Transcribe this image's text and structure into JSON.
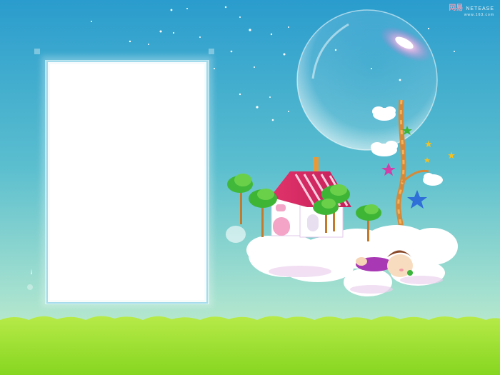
{
  "watermark": {
    "logo_text": "网易",
    "brand": "NETEASE",
    "url": "www.163.com"
  },
  "photo_frame": {
    "content": ""
  },
  "colors": {
    "sky_top": "#2a9ccd",
    "sky_bottom": "#c5ecd0",
    "grass": "#9adf2a",
    "roof": "#e0336b",
    "tree": "#4cc42c"
  }
}
